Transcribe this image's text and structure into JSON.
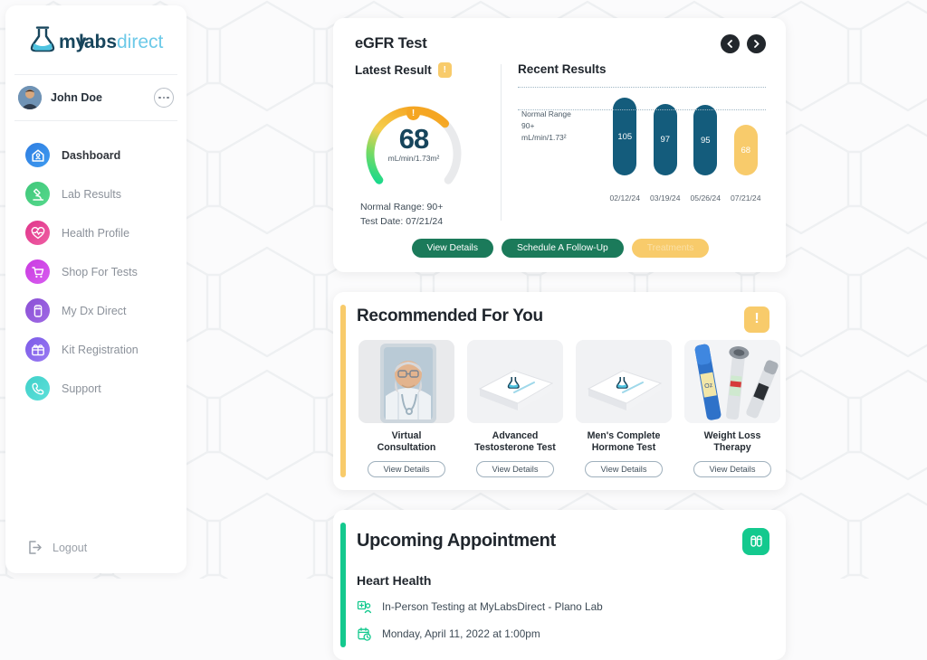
{
  "brand": {
    "logo_text_1": "my",
    "logo_text_2": "labs",
    "logo_text_3": "direct",
    "color_dark": "#17455c",
    "color_light": "#4ec3e0",
    "color_green": "#14c98e",
    "color_teal": "#1b7a5a",
    "color_yellow": "#f8cb6b"
  },
  "sidebar": {
    "user": {
      "name": "John Doe",
      "menu_icon": "ellipsis-icon",
      "avatar": "avatar"
    },
    "items": [
      {
        "label": "Dashboard",
        "icon": "home-icon",
        "color1": "#2f7de1",
        "color2": "#3e9bf0",
        "active": true
      },
      {
        "label": "Lab Results",
        "icon": "microscope-icon",
        "color1": "#3fc77a",
        "color2": "#56d98c",
        "active": false
      },
      {
        "label": "Health Profile",
        "icon": "heartbeat-icon",
        "color1": "#e0348a",
        "color2": "#ef5fa4",
        "active": false
      },
      {
        "label": "Shop For Tests",
        "icon": "cart-icon",
        "color1": "#c93ae0",
        "color2": "#d85df0",
        "active": false
      },
      {
        "label": "My Dx Direct",
        "icon": "vial-icon",
        "color1": "#8b4fd6",
        "color2": "#9f6ae4",
        "active": false
      },
      {
        "label": "Kit Registration",
        "icon": "kit-box-icon",
        "color1": "#7b5ae8",
        "color2": "#9a7bf2",
        "active": false
      },
      {
        "label": "Support",
        "icon": "phone-icon",
        "color1": "#3fd0c9",
        "color2": "#5ee0da",
        "active": false
      }
    ],
    "logout": {
      "label": "Logout",
      "icon": "logout-icon"
    }
  },
  "egfr": {
    "title": "eGFR Test",
    "prev_icon": "chevron-left-icon",
    "next_icon": "chevron-right-icon",
    "latest": {
      "heading": "Latest Result",
      "alert_icon": "warning-badge-icon",
      "value": "68",
      "unit": "mL/min/1.73m²",
      "normal_range_line": "Normal Range: 90+",
      "test_date_line": "Test Date: 07/21/24",
      "gauge_percent": 68
    },
    "recent": {
      "heading": "Recent Results",
      "note_line_1": "Normal Range",
      "note_line_2": "90+",
      "note_line_3": "mL/min/1.73²"
    },
    "buttons": [
      {
        "label": "View Details",
        "style": "green"
      },
      {
        "label": "Schedule A Follow-Up",
        "style": "green"
      },
      {
        "label": "Treatments",
        "style": "yellow"
      }
    ]
  },
  "chart_data": {
    "type": "bar",
    "title": "Recent Results",
    "categories": [
      "02/12/24",
      "03/19/24",
      "05/26/24",
      "07/21/24"
    ],
    "values": [
      105,
      97,
      95,
      68
    ],
    "colors": [
      "#145c7c",
      "#145c7c",
      "#145c7c",
      "#f8cb6b"
    ],
    "normal_range_min": 90,
    "normal_range_label": "Normal Range 90+ mL/min/1.73²",
    "ylabel": "mL/min/1.73m²",
    "xlabel": "",
    "ylim": [
      0,
      120
    ],
    "gridlines": [
      90,
      120
    ],
    "grid": true,
    "legend": false
  },
  "recommended": {
    "title": "Recommended For You",
    "alert_icon": "warning-badge-icon",
    "accent_color": "#f8cb6b",
    "products": [
      {
        "name": "Virtual\nConsultation",
        "image": "doctor-video-photo",
        "button": "View Details"
      },
      {
        "name": "Advanced\nTestosterone Test",
        "image": "test-kit-box-photo",
        "button": "View Details"
      },
      {
        "name": "Men's Complete\nHormone Test",
        "image": "test-kit-box-photo",
        "button": "View Details"
      },
      {
        "name": "Weight Loss\nTherapy",
        "image": "injection-pens-photo",
        "button": "View Details"
      }
    ]
  },
  "appointment": {
    "title": "Upcoming Appointment",
    "badge_icon": "test-tubes-icon",
    "accent_color": "#14c98e",
    "subtitle": "Heart Health",
    "location_icon": "lab-location-icon",
    "location": "In-Person Testing at MyLabsDirect - Plano Lab",
    "datetime_icon": "calendar-clock-icon",
    "datetime": "Monday, April 11, 2022 at 1:00pm"
  }
}
